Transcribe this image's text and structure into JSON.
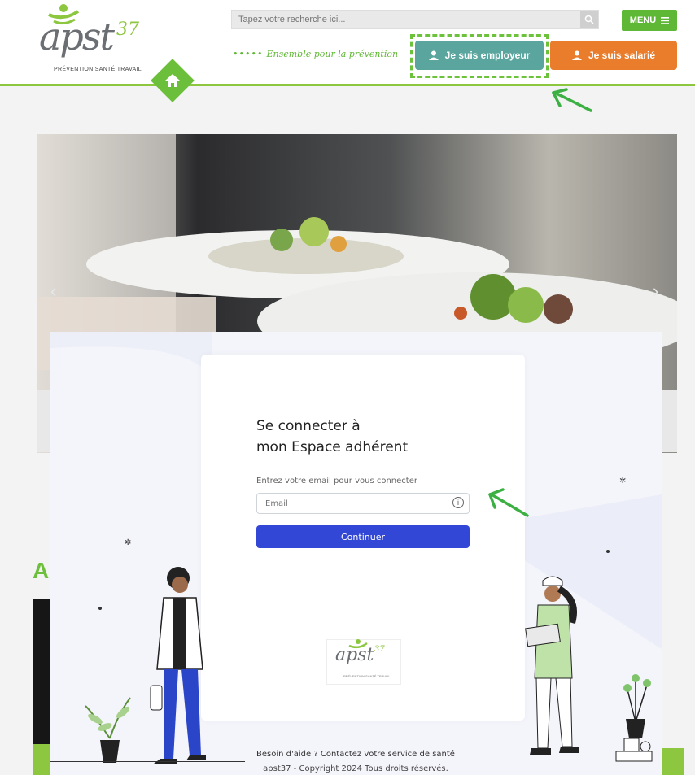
{
  "header": {
    "logo_text": "apst",
    "logo_sup": "37",
    "logo_subtitle": "PRÉVENTION SANTÉ TRAVAIL",
    "search_placeholder": "Tapez votre recherche ici...",
    "menu_label": "MENU",
    "tagline": "Ensemble pour la prévention",
    "employer_button": "Je suis employeur",
    "employee_button": "Je suis salarié",
    "colors": {
      "green": "#6cbf3a",
      "teal": "#5aa69f",
      "orange": "#ea7d2b"
    }
  },
  "background": {
    "section_letter": "A"
  },
  "login": {
    "title_line1": "Se connecter à",
    "title_line2": "mon Espace adhérent",
    "email_label": "Entrez votre email pour vous connecter",
    "email_placeholder": "Email",
    "continue_label": "Continuer",
    "card_logo_text": "apst",
    "card_logo_sup": "37",
    "card_logo_subtitle": "PRÉVENTION SANTÉ TRAVAIL",
    "help_text": "Besoin d'aide ? Contactez votre service de santé",
    "copyright": "apst37 - Copyright 2024 Tous droits réservés.",
    "button_color": "#3347d6"
  }
}
